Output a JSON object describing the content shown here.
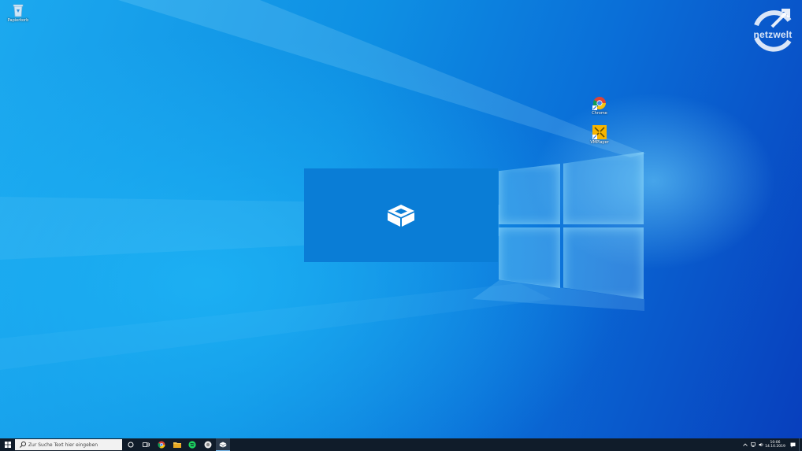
{
  "desktop": {
    "icons": [
      {
        "name": "recycle-bin",
        "label": "Papierkorb"
      },
      {
        "name": "chrome",
        "label": "Chrome"
      },
      {
        "name": "vmware",
        "label": "VMPlayer"
      }
    ]
  },
  "watermark": {
    "text": "netzwelt"
  },
  "taskbar": {
    "search_placeholder": "Zur Suche Text hier eingeben",
    "clock_time": "10:06",
    "clock_date": "14.10.2019"
  },
  "colors": {
    "accent": "#0a7dd6",
    "taskbar": "#101c2a",
    "desktop_dark": "#083fbd",
    "desktop_light": "#1ca9ef"
  }
}
